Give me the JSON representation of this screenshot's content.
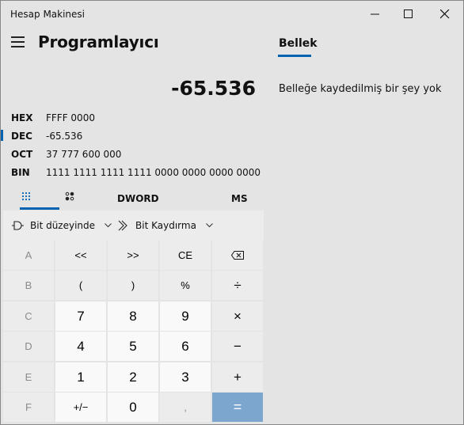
{
  "window": {
    "title": "Hesap Makinesi"
  },
  "header": {
    "mode_title": "Programlayıcı"
  },
  "display": {
    "value": "-65.536"
  },
  "radix": [
    {
      "label": "HEX",
      "value": "FFFF 0000"
    },
    {
      "label": "DEC",
      "value": "-65.536"
    },
    {
      "label": "OCT",
      "value": "37 777 600 000"
    },
    {
      "label": "BIN",
      "value": "1111 1111 1111 1111 0000 0000 0000 0000"
    }
  ],
  "tabs": {
    "word_size": "DWORD",
    "memory_store": "MS"
  },
  "operators": {
    "bitwise": "Bit düzeyinde",
    "bitshift": "Bit Kaydırma"
  },
  "keys": {
    "r1": [
      "A",
      "<<",
      ">>",
      "CE",
      "⌫"
    ],
    "r2": [
      "B",
      "(",
      ")",
      "%",
      "÷"
    ],
    "r3": [
      "C",
      "7",
      "8",
      "9",
      "×"
    ],
    "r4": [
      "D",
      "4",
      "5",
      "6",
      "−"
    ],
    "r5": [
      "E",
      "1",
      "2",
      "3",
      "+"
    ],
    "r6": [
      "F",
      "+/−",
      "0",
      ",",
      "="
    ]
  },
  "memory": {
    "tab_label": "Bellek",
    "empty_message": "Belleğe kaydedilmiş bir şey yok"
  },
  "colors": {
    "accent": "#0063b1",
    "equals": "#7da6cf",
    "background": "#e4e4e4"
  }
}
